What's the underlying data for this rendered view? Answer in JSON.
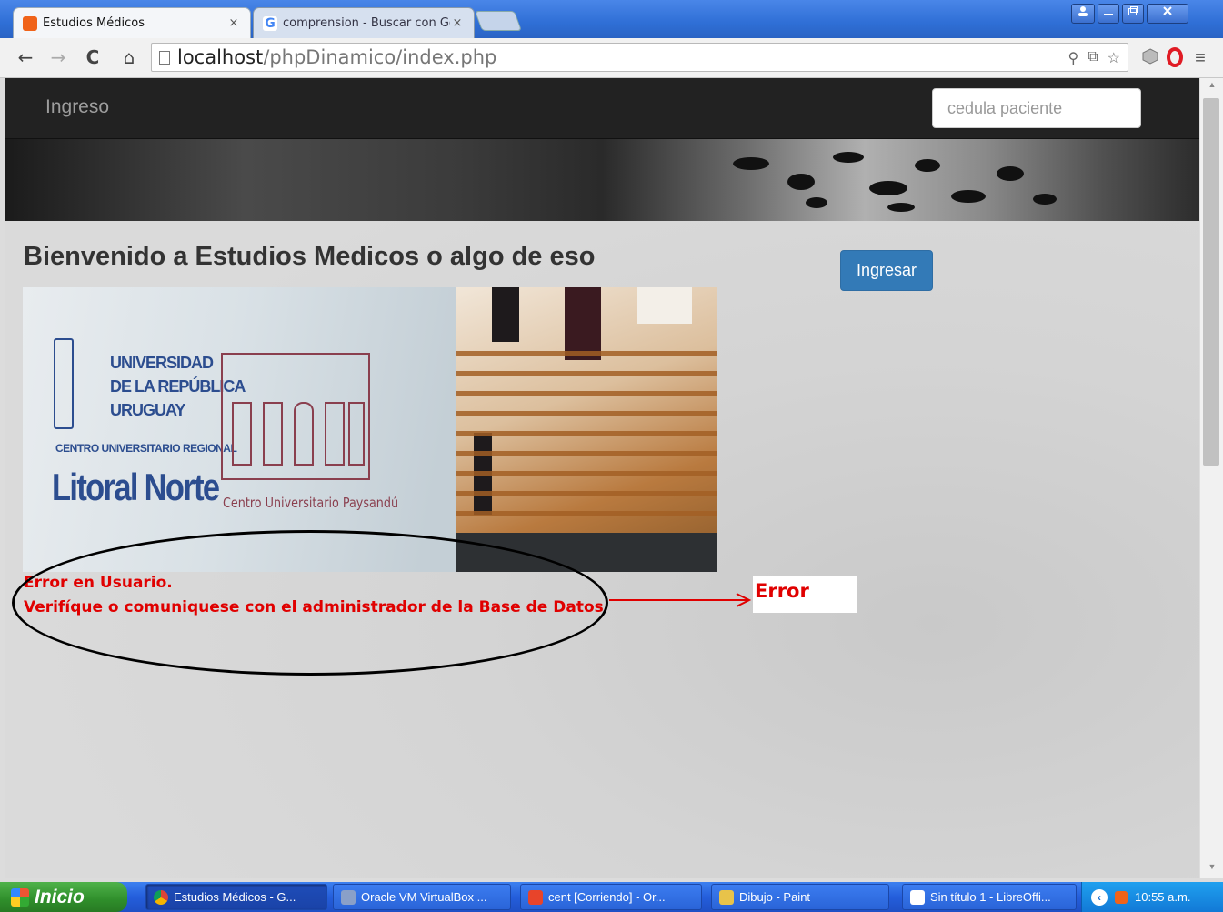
{
  "browser": {
    "tabs": [
      {
        "title": "Estudios Médicos",
        "close": "×",
        "active": true
      },
      {
        "title": "comprension - Buscar con Go",
        "close": "×",
        "active": false
      }
    ],
    "url": {
      "host": "localhost",
      "path": "/phpDinamico/index.php"
    },
    "icons": {
      "back": "back-arrow-icon",
      "forward": "forward-arrow-icon",
      "reload": "reload-icon",
      "home": "home-icon",
      "star": "bookmark-star-icon",
      "menu": "menu-icon"
    }
  },
  "page": {
    "navbar": {
      "brand": "Ingreso",
      "search_placeholder": "cedula paciente"
    },
    "welcome": "Bienvenido a Estudios Medicos o algo de eso",
    "ingresar_button": "Ingresar",
    "hero": {
      "university": [
        "UNIVERSIDAD",
        "DE LA REPÚBLICA",
        "URUGUAY"
      ],
      "centro": "CENTRO UNIVERSITARIO REGIONAL",
      "litoral": "Litoral Norte",
      "cup": "Centro Universitario Paysandú"
    },
    "error_line_1": "Error en Usuario.",
    "error_line_2": "Verifíque o comuniquese con el administrador de la Base de Datos",
    "error_label": "Error"
  },
  "taskbar": {
    "start": "Inicio",
    "tasks": [
      {
        "label": "Estudios Médicos - G...",
        "active": true
      },
      {
        "label": "Oracle VM VirtualBox ...",
        "active": false
      },
      {
        "label": "cent [Corriendo] - Or...",
        "active": false
      },
      {
        "label": "Dibujo - Paint",
        "active": false
      },
      {
        "label": "Sin título 1 - LibreOffi...",
        "active": false
      }
    ],
    "clock": "10:55 a.m."
  },
  "colors": {
    "accent": "#337ab7",
    "navbar": "#222222",
    "error": "#e00000",
    "taskbar": "#245edb"
  }
}
